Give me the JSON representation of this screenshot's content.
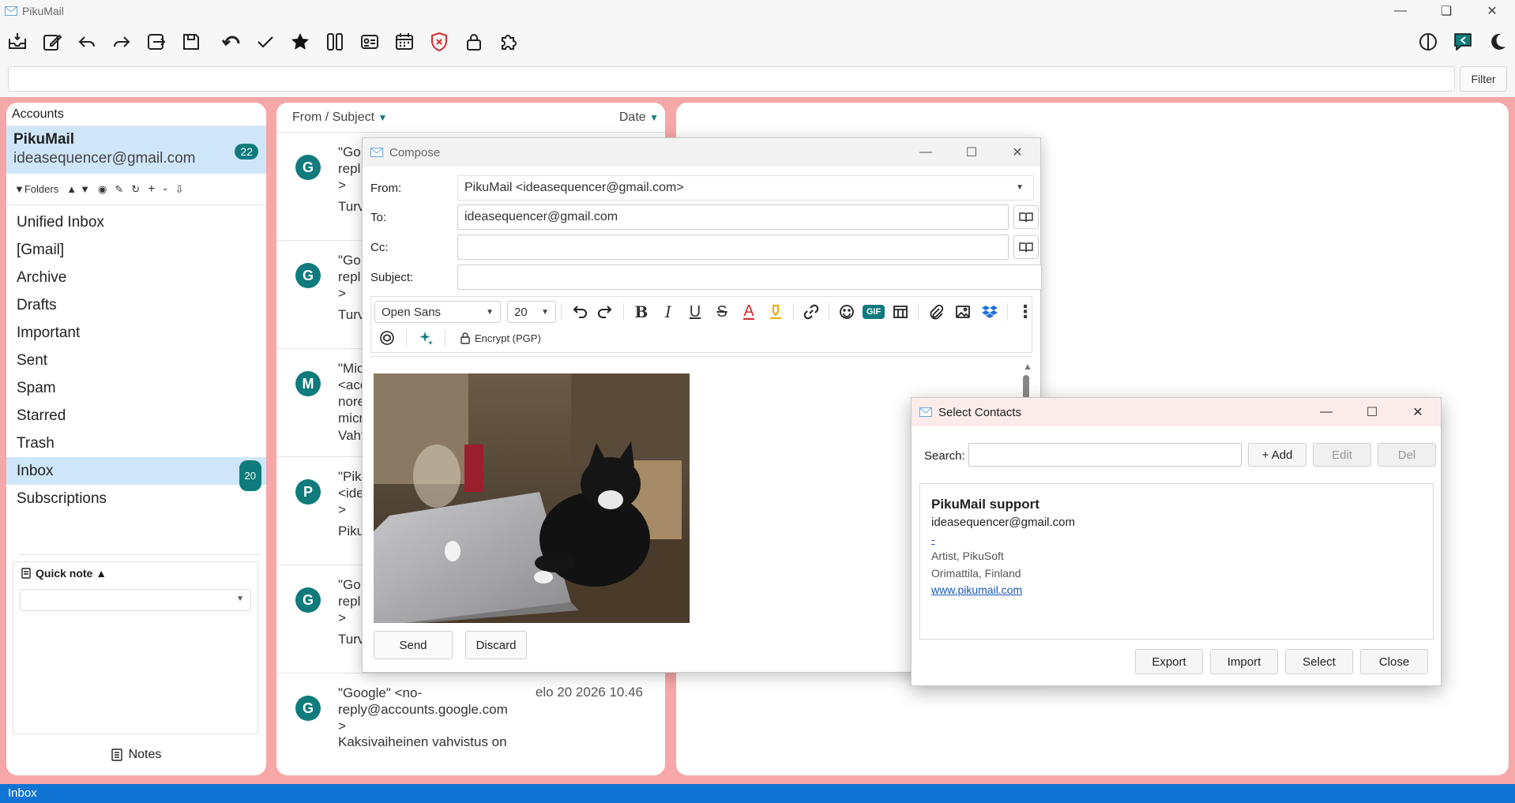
{
  "app": {
    "title": "PikuMail",
    "status": "Inbox",
    "filter_button": "Filter",
    "filter_value": ""
  },
  "left": {
    "accounts_header": "Accounts",
    "account": {
      "name": "PikuMail",
      "email": "ideasequencer@gmail.com",
      "unread": "22"
    },
    "folders_label": "▼Folders",
    "folders": [
      {
        "label": "Unified Inbox"
      },
      {
        "label": "[Gmail]"
      },
      {
        "label": "Archive"
      },
      {
        "label": "Drafts"
      },
      {
        "label": "Important"
      },
      {
        "label": "Sent"
      },
      {
        "label": "Spam"
      },
      {
        "label": "Starred"
      },
      {
        "label": "Trash"
      },
      {
        "label": "Inbox",
        "badge": "20"
      },
      {
        "label": "Subscriptions"
      }
    ],
    "quick_note": "Quick note ▲",
    "notes": "Notes"
  },
  "middle": {
    "col_from": "From / Subject",
    "col_date": "Date",
    "messages": [
      {
        "avatar": "G",
        "from": [
          "\"Go",
          "repl",
          ">"
        ],
        "subject": "Turv"
      },
      {
        "avatar": "G",
        "from": [
          "\"Go",
          "repl",
          ">"
        ],
        "subject": "Turv"
      },
      {
        "avatar": "M",
        "from": [
          "\"Mic",
          "<acc",
          "nore",
          "micr"
        ],
        "subject": "Vaht"
      },
      {
        "avatar": "P",
        "from": [
          "\"Pik",
          "<ide",
          ">"
        ],
        "subject": "Piku"
      },
      {
        "avatar": "G",
        "from": [
          "\"Go",
          "repl",
          ">"
        ],
        "subject": "Turv"
      },
      {
        "avatar": "G",
        "from": [
          "\"Google\" <no-",
          "reply@accounts.google.com",
          ">"
        ],
        "subject": "Kaksivaiheinen vahvistus on",
        "date": "elo 20 2026 10.46"
      }
    ]
  },
  "compose": {
    "title": "Compose",
    "from_label": "From:",
    "from_value": "PikuMail  <ideasequencer@gmail.com>",
    "to_label": "To:",
    "to_value": "ideasequencer@gmail.com",
    "cc_label": "Cc:",
    "cc_value": "",
    "subject_label": "Subject:",
    "subject_value": "",
    "font": "Open Sans",
    "font_size": "20",
    "gif": "GIF",
    "encrypt": "Encrypt (PGP)",
    "send": "Send",
    "discard": "Discard"
  },
  "contacts": {
    "title": "Select Contacts",
    "search_label": "Search:",
    "search_value": "",
    "add": "+ Add",
    "edit": "Edit",
    "del": "Del",
    "entry": {
      "name": "PikuMail support",
      "email": "ideasequencer@gmail.com",
      "dash": "-",
      "title": "Artist, PikuSoft",
      "location": "Orimattila, Finland",
      "website": "www.pikumail.com"
    },
    "export": "Export",
    "import": "Import",
    "select": "Select",
    "close": "Close"
  },
  "colors": {
    "accent": "#0f7b7c",
    "pane_bg": "#f6a7a7",
    "selected": "#cfe6fa",
    "status": "#1174d4"
  }
}
